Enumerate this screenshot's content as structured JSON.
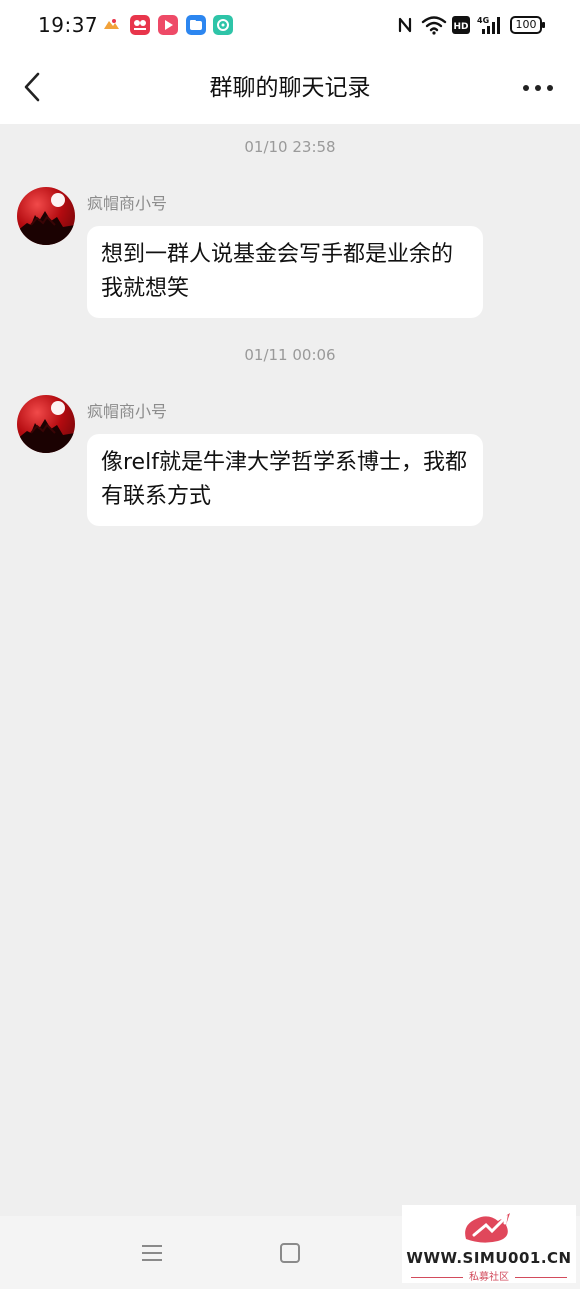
{
  "status_bar": {
    "time": "19:37",
    "battery": "100",
    "app_icons": [
      "photos-icon",
      "app-icon",
      "video-icon",
      "files-icon",
      "assistant-icon"
    ],
    "system_icons": [
      "nfc-icon",
      "wifi-icon",
      "hd-icon",
      "signal-4g-icon"
    ]
  },
  "header": {
    "title": "群聊的聊天记录",
    "back_icon": "chevron-left-icon",
    "more_icon": "more-horizontal-icon"
  },
  "messages": [
    {
      "timestamp": "01/10 23:58",
      "sender": "疯帽商小号",
      "text": "想到一群人说基金会写手都是业余的我就想笑"
    },
    {
      "timestamp": "01/11 00:06",
      "sender": "疯帽商小号",
      "text": "像relf就是牛津大学哲学系博士，我都有联系方式"
    }
  ],
  "nav_bar": {
    "menu_icon": "menu-icon",
    "home_icon": "home-square-icon"
  },
  "watermark": {
    "url": "WWW.SIMU001.CN",
    "subtitle": "私募社区"
  },
  "colors": {
    "background": "#efefef",
    "bubble": "#ffffff",
    "timestamp": "#9a9a9a",
    "sender": "#8c8c8c",
    "watermark_accent": "#d24b5c"
  }
}
